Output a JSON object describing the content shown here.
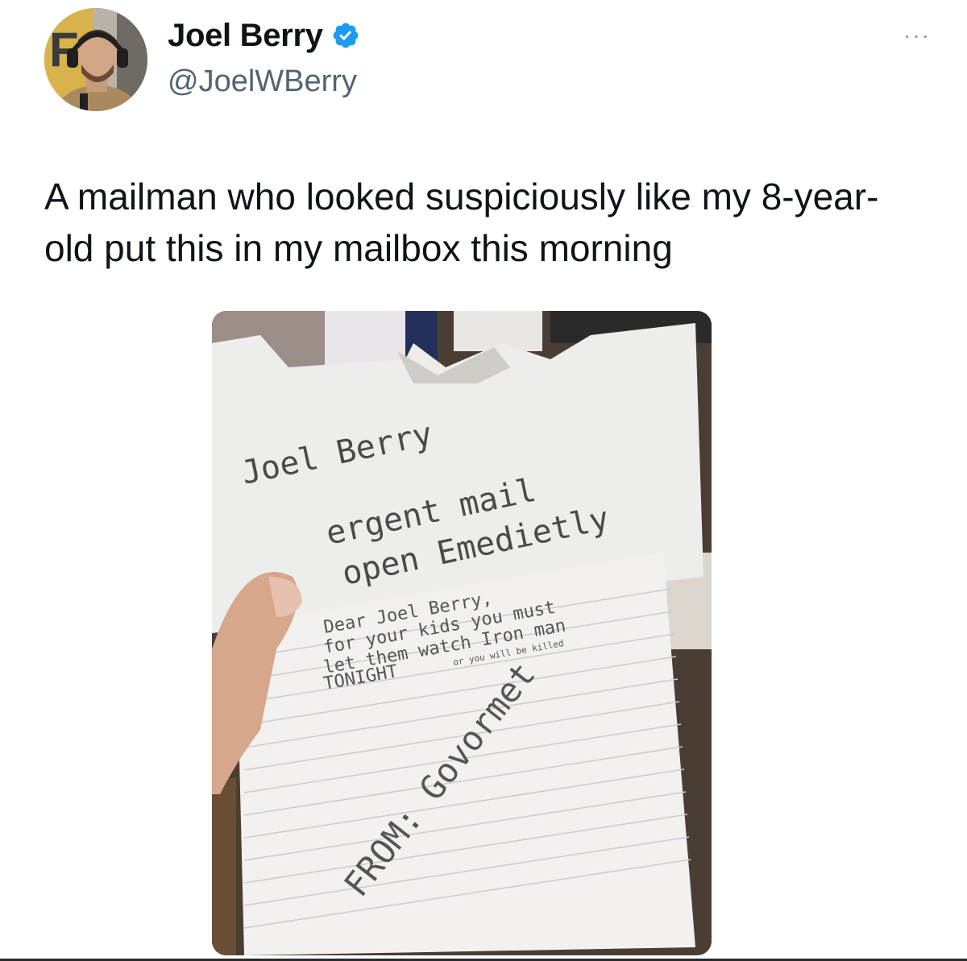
{
  "author": {
    "display_name": "Joel Berry",
    "handle": "@JoelWBerry",
    "verified": true,
    "avatar_icon": "profile-photo"
  },
  "more_label": "···",
  "tweet": {
    "text": "A mailman who looked suspiciously like my 8-year-old put this in my mailbox this morning"
  },
  "photo": {
    "envelope_lines": [
      "Joel Berry",
      "ergent mail",
      "open Emedietly"
    ],
    "letter_lines": [
      "Dear Joel Berry,",
      "for your kids you must",
      "let them watch Iron man",
      "TONIGHT",
      "or you will be killed"
    ],
    "signature": "FROM: Govormet"
  },
  "colors": {
    "verified_blue": "#1d9bf0",
    "handle_gray": "#536471"
  }
}
